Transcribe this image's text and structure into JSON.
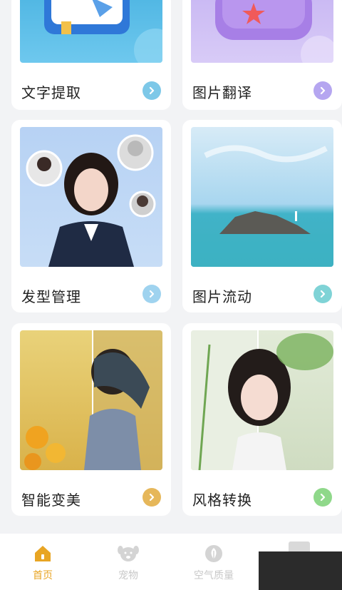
{
  "cards": [
    {
      "label": "文字提取",
      "accent": "#7dc8e8"
    },
    {
      "label": "图片翻译",
      "accent": "#b5a6f0"
    },
    {
      "label": "发型管理",
      "accent": "#9fd3ef"
    },
    {
      "label": "图片流动",
      "accent": "#7fd3d6"
    },
    {
      "label": "智能变美",
      "accent": "#e6b75a"
    },
    {
      "label": "风格转换",
      "accent": "#8fd88a"
    }
  ],
  "tabbar": {
    "tabs": [
      {
        "label": "首页",
        "icon": "home-icon",
        "active": true
      },
      {
        "label": "宠物",
        "icon": "pet-icon",
        "active": false
      },
      {
        "label": "空气质量",
        "icon": "leaf-icon",
        "active": false
      }
    ],
    "active_color": "#e8a524",
    "inactive_color": "#c8c8c8"
  }
}
